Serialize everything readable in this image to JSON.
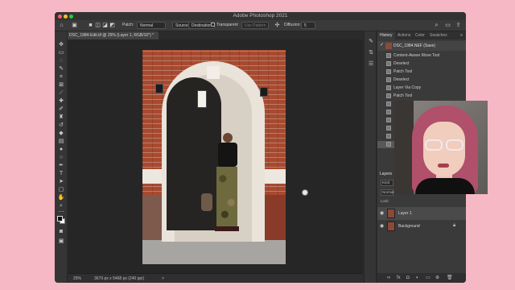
{
  "window": {
    "title": "Adobe Photoshop 2021"
  },
  "options_bar": {
    "patch_label": "Patch:",
    "patch_mode": "Normal",
    "source_btn": "Source",
    "destination_btn": "Destination",
    "transparent_label": "Transparent",
    "use_pattern_btn": "Use Pattern",
    "diffusion_label": "Diffusion:",
    "diffusion_value": "5"
  },
  "document_tab": {
    "label": "DSC_1984-Edit.tif @ 25% (Layer 1, RGB/16*) *"
  },
  "status_bar": {
    "zoom": "25%",
    "doc_info": "3670 px x 5468 px (240 ppi)",
    "arrow": ">"
  },
  "history_panel": {
    "tabs": [
      "History",
      "Actions",
      "Color",
      "Swatches"
    ],
    "snapshot": "DSC_1984.NEF (Save)",
    "items": [
      "Content-Aware Move Tool",
      "Deselect",
      "Patch Tool",
      "Deselect",
      "Layer Via Copy",
      "Patch Tool"
    ]
  },
  "layers_panel": {
    "tab": "Layers",
    "kind": "Kind",
    "blend": "Normal",
    "lock_label": "Lock:",
    "layers": [
      {
        "name": "Layer 1",
        "selected": true
      },
      {
        "name": "Background",
        "selected": false,
        "locked": true
      }
    ],
    "footer_fx": "fx"
  },
  "colors": {
    "background": "#f5b8c4",
    "app_bg": "#2b2b2b",
    "panel_bg": "#3a3a3a"
  }
}
